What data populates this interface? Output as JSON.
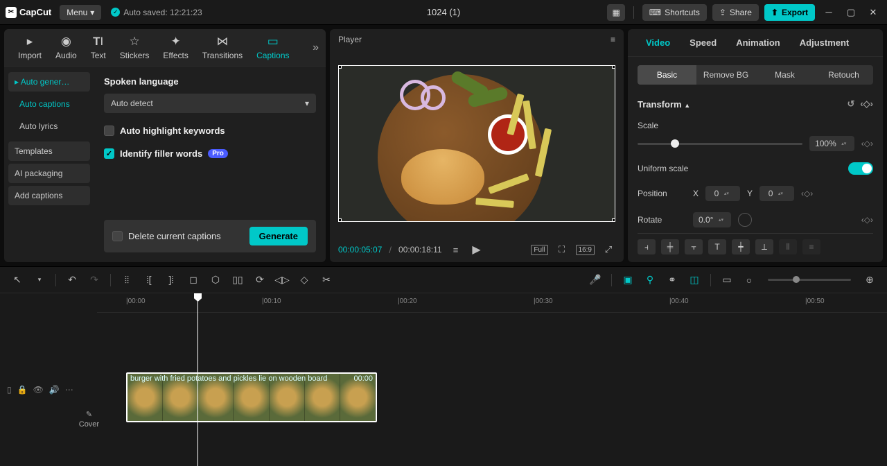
{
  "titlebar": {
    "app_name": "CapCut",
    "menu": "Menu",
    "autosave": "Auto saved: 12:21:23",
    "project_title": "1024 (1)",
    "shortcuts": "Shortcuts",
    "share": "Share",
    "export": "Export"
  },
  "left_tabs": {
    "import": "Import",
    "audio": "Audio",
    "text": "Text",
    "stickers": "Stickers",
    "effects": "Effects",
    "transitions": "Transitions",
    "captions": "Captions"
  },
  "left_side": {
    "auto_gen": "Auto gener…",
    "auto_captions": "Auto captions",
    "auto_lyrics": "Auto lyrics",
    "templates": "Templates",
    "ai_packaging": "AI packaging",
    "add_captions": "Add captions"
  },
  "captions_panel": {
    "lang_label": "Spoken language",
    "lang_value": "Auto detect",
    "highlight": "Auto highlight keywords",
    "filler": "Identify filler words",
    "pro": "Pro",
    "delete": "Delete current captions",
    "generate": "Generate"
  },
  "player": {
    "title": "Player",
    "time_current": "00:00:05:07",
    "time_total": "00:00:18:11",
    "full": "Full",
    "ratio": "16:9"
  },
  "right": {
    "tabs": {
      "video": "Video",
      "speed": "Speed",
      "animation": "Animation",
      "adjustment": "Adjustment"
    },
    "pills": {
      "basic": "Basic",
      "removebg": "Remove BG",
      "mask": "Mask",
      "retouch": "Retouch"
    },
    "transform": "Transform",
    "scale": "Scale",
    "scale_value": "100%",
    "uniform": "Uniform scale",
    "position": "Position",
    "x_label": "X",
    "x_value": "0",
    "y_label": "Y",
    "y_value": "0",
    "rotate": "Rotate",
    "rotate_value": "0.0°"
  },
  "timeline": {
    "ticks": [
      "|00:00",
      "|00:10",
      "|00:20",
      "|00:30",
      "|00:40",
      "|00:50"
    ],
    "cover": "Cover",
    "clip_label": "burger with fried potatoes and pickles lie on wooden board",
    "clip_time": "00:00"
  }
}
